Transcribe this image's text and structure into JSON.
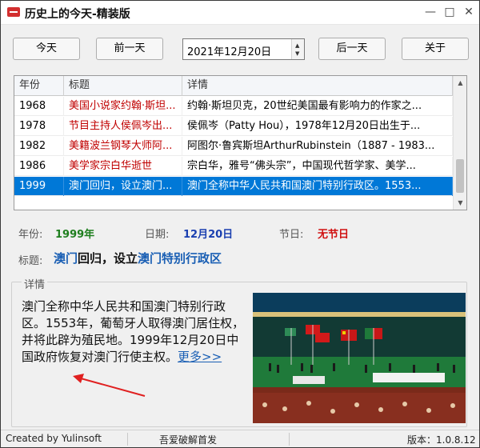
{
  "window": {
    "title": "历史上的今天-精装版"
  },
  "toolbar": {
    "today": "今天",
    "prev": "前一天",
    "date_value": "2021年12月20日",
    "next": "后一天",
    "about": "关于"
  },
  "table": {
    "columns": [
      "年份",
      "标题",
      "详情"
    ],
    "rows": [
      {
        "year": "1968",
        "title": "美国小说家约翰·斯坦...",
        "detail": "约翰·斯坦贝克，20世纪美国最有影响力的作家之..."
      },
      {
        "year": "1978",
        "title": "节目主持人侯佩岑出...",
        "detail": "侯佩岑（Patty Hou），1978年12月20日出生于..."
      },
      {
        "year": "1982",
        "title": "美籍波兰钢琴大师阿...",
        "detail": "阿图尔·鲁宾斯坦ArthurRubinstein（1887 - 1983..."
      },
      {
        "year": "1986",
        "title": "美学家宗白华逝世",
        "detail": "宗白华，雅号“佛头宗”，中国现代哲学家、美学..."
      },
      {
        "year": "1999",
        "title": "澳门回归，设立澳门...",
        "detail": "澳门全称中华人民共和国澳门特别行政区。1553..."
      }
    ],
    "selected_index": 4
  },
  "info": {
    "year_label": "年份:",
    "year_value": "1999年",
    "date_label": "日期:",
    "date_value": "12月20日",
    "holiday_label": "节日:",
    "holiday_value": "无节日",
    "title_label": "标题:",
    "title_part1": "澳门",
    "title_part2": "回归，设立",
    "title_part3": "澳门",
    "title_part4": "特别行政区"
  },
  "detail": {
    "legend": "详情",
    "text": "澳门全称中华人民共和国澳门特别行政区。1553年，葡萄牙人取得澳门居住权，并将此辟为殖民地。1999年12月20日中国政府恢复对澳门行使主权。",
    "more": "更多>>"
  },
  "status": {
    "created_by": "Created by Yulinsoft",
    "center": "吾爱破解首发",
    "version": "版本：1.0.8.12"
  },
  "colors": {
    "year_value": "#1e7e1e",
    "date_value": "#1a3fb0",
    "holiday_value": "#d01010",
    "title_link": "#1a5fb4",
    "selected_row": "#0078d7"
  }
}
